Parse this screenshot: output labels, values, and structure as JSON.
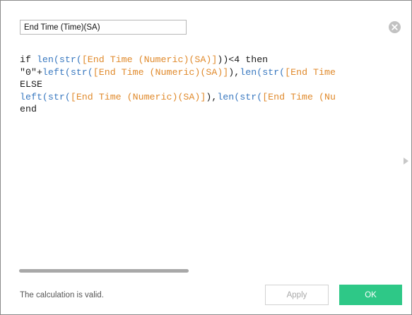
{
  "calc_name": "End Time (Time)(SA)",
  "icons": {
    "close": "close-circle-icon",
    "expand": "chevron-right-icon"
  },
  "colors": {
    "function": "#3a79c0",
    "field": "#e08a2c",
    "ok_button": "#2ec887"
  },
  "code": {
    "line1": {
      "t1": "if ",
      "t2": "len",
      "t3": "(",
      "t4": "str",
      "t5": "(",
      "t6": "[End Time (Numeric)(SA)]",
      "t7": "))<4 then"
    },
    "line2": {
      "t1": "\"0\"+",
      "t2": "left",
      "t3": "(",
      "t4": "str",
      "t5": "(",
      "t6": "[End Time (Numeric)(SA)]",
      "t7": "),",
      "t8": "len",
      "t9": "(",
      "t10": "str",
      "t11": "(",
      "t12": "[End Time"
    },
    "line3": {
      "t1": "ELSE"
    },
    "line4": {
      "t1": "left",
      "t2": "(",
      "t3": "str",
      "t4": "(",
      "t5": "[End Time (Numeric)(SA)]",
      "t6": "),",
      "t7": "len",
      "t8": "(",
      "t9": "str",
      "t10": "(",
      "t11": "[End Time (Nu"
    },
    "line5": {
      "t1": "end"
    }
  },
  "status": "The calculation is valid.",
  "buttons": {
    "apply": "Apply",
    "ok": "OK"
  }
}
